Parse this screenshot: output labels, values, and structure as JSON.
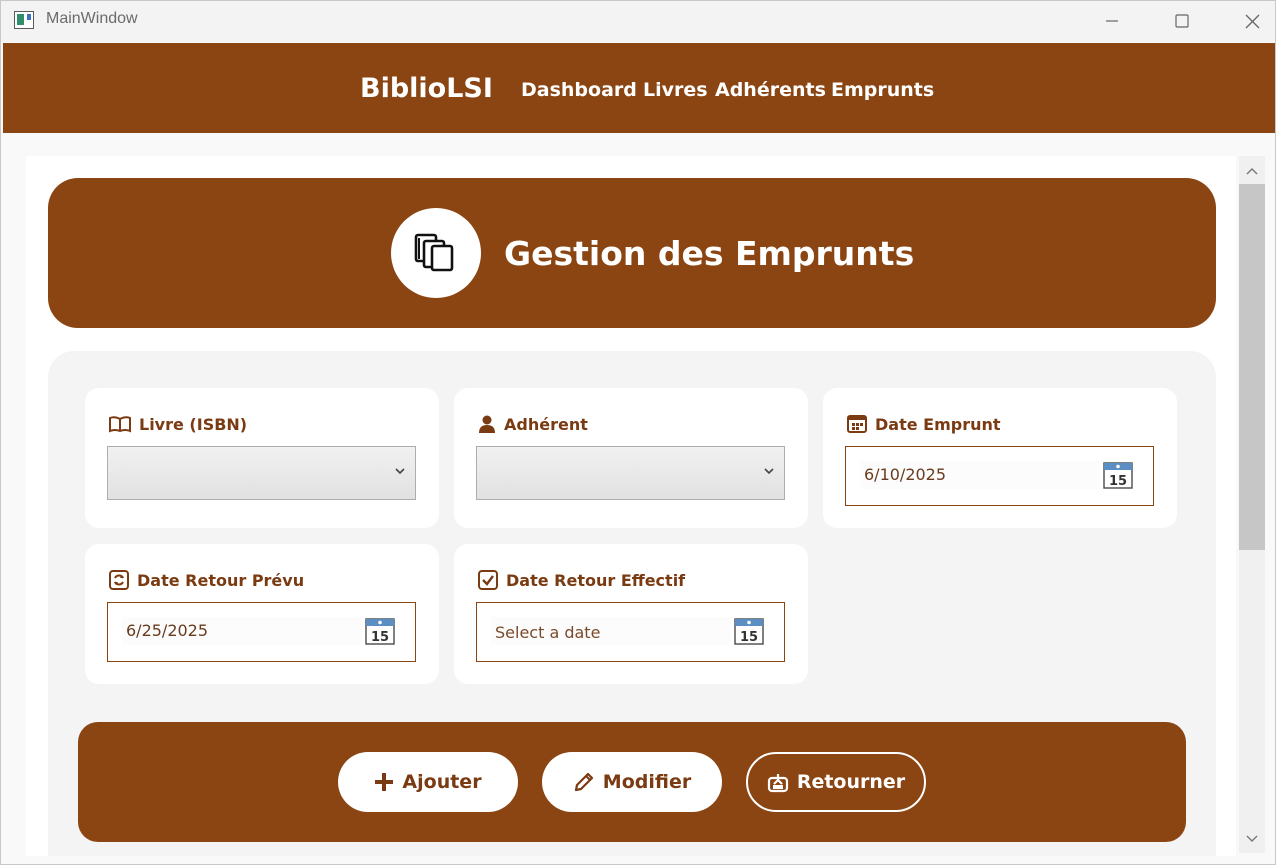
{
  "window": {
    "title": "MainWindow",
    "controls": [
      "minimize-icon",
      "maximize-icon",
      "close-icon"
    ]
  },
  "nav": {
    "brand": "BiblioLSI",
    "links": [
      "Dashboard",
      "Livres",
      "Adhérents",
      "Emprunts"
    ]
  },
  "header": {
    "icon": "books-icon",
    "title": "Gestion des Emprunts"
  },
  "form": {
    "livre": {
      "label": "Livre (ISBN)",
      "icon": "open-book-icon",
      "value": ""
    },
    "adherent": {
      "label": "Adhérent",
      "icon": "user-icon",
      "value": ""
    },
    "date_emprunt": {
      "label": "Date Emprunt",
      "icon": "calendar-icon",
      "value": "6/10/2025"
    },
    "date_retour_prevu": {
      "label": "Date Retour Prévu",
      "icon": "refresh-calendar-icon",
      "value": "6/25/2025"
    },
    "date_retour_effectif": {
      "label": "Date Retour Effectif",
      "icon": "checkbox-icon",
      "placeholder": "Select a date"
    },
    "calendar_button_day": "15"
  },
  "actions": {
    "ajouter": {
      "label": "Ajouter",
      "icon": "plus-icon"
    },
    "modifier": {
      "label": "Modifier",
      "icon": "pencil-icon"
    },
    "retourner": {
      "label": "Retourner",
      "icon": "return-box-icon"
    }
  },
  "colors": {
    "brand": "#8b4513",
    "label": "#7a3b12",
    "panel": "#f4f4f4"
  }
}
